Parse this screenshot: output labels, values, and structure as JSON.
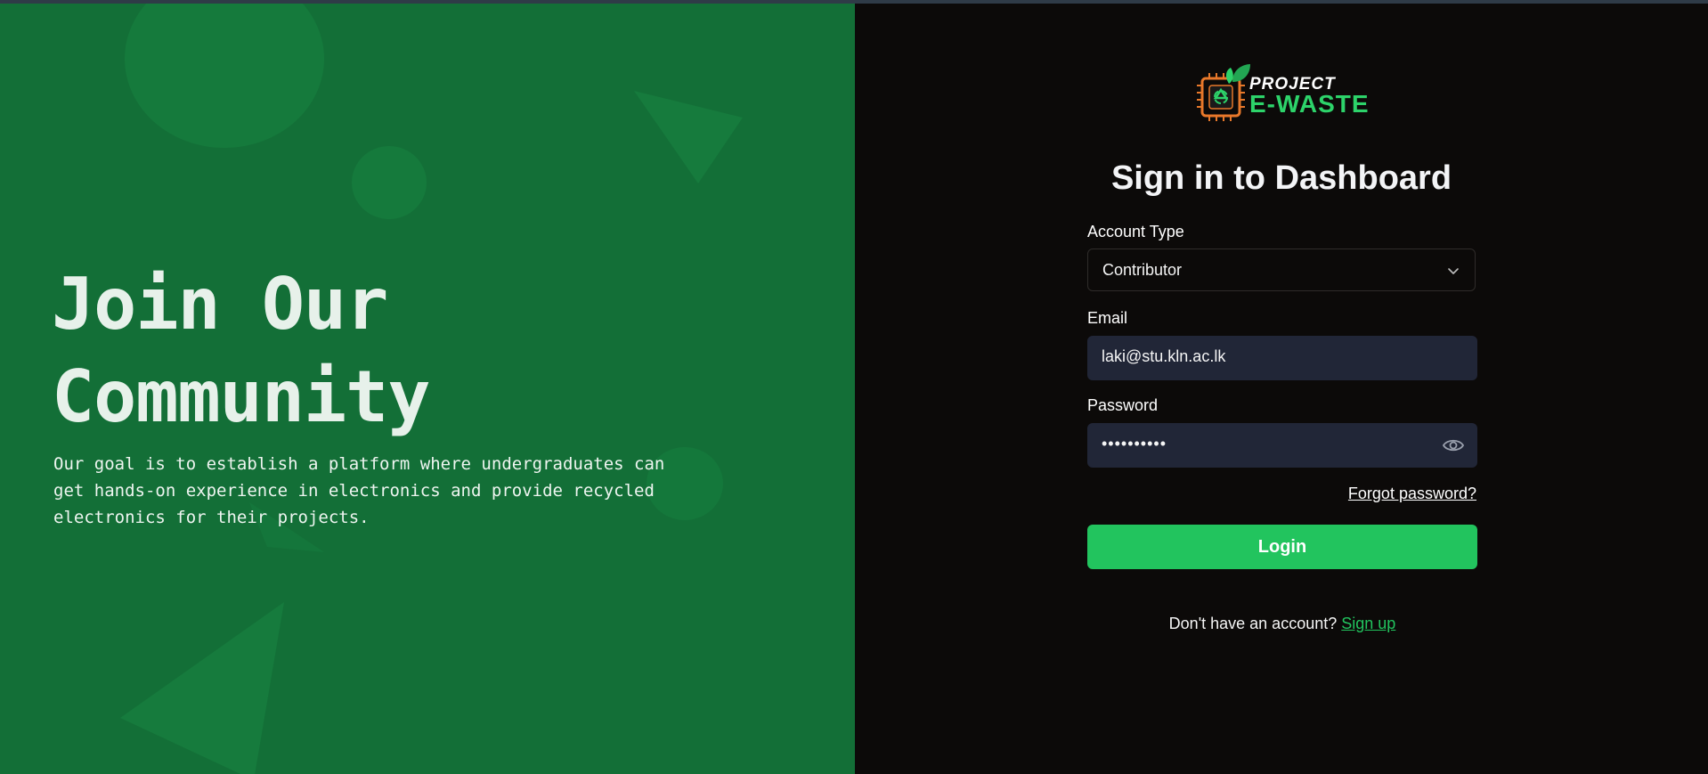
{
  "left_panel": {
    "title_line_1": "Join Our",
    "title_line_2": "Community",
    "description": "Our goal is to establish a platform where undergraduates can get hands-on experience in electronics and provide recycled electronics for their projects.",
    "background_color": "#136f37"
  },
  "logo": {
    "line_1": "PROJECT",
    "line_2": "E-WASTE",
    "icon": "recycle-chip-logo"
  },
  "form": {
    "title": "Sign in to Dashboard",
    "account_type": {
      "label": "Account Type",
      "value": "Contributor"
    },
    "email": {
      "label": "Email",
      "value": "laki@stu.kln.ac.lk"
    },
    "password": {
      "label": "Password",
      "masked_value": "••••••••••",
      "toggle_icon": "eye-icon"
    },
    "forgot_password": "Forgot password?",
    "login_label": "Login",
    "signup_prompt": "Don't have an account?",
    "signup_link": "Sign up"
  },
  "colors": {
    "accent": "#22c45e",
    "panel_dark": "#0c0a09",
    "input_bg": "#212637"
  }
}
